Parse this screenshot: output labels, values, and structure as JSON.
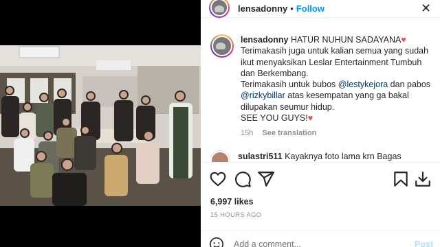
{
  "header": {
    "username": "lensadonny",
    "separator": "•",
    "follow_label": "Follow",
    "close_glyph": "✕"
  },
  "caption": {
    "username": "lensadonny",
    "line1": "HATUR NUHUN SADAYANA",
    "heart": "♥",
    "body1": "Terimakasih juga untuk kalian semua yang sudah ikut menyaksikan Leslar Entertainment Tumbuh dan Berkembang.",
    "body2_a": "Terimakasih untuk bubos ",
    "mention1": "@lestykejora",
    "body2_b": " dan pabos ",
    "mention2": "@rizkybillar",
    "body2_c": " atas kesempatan yang ga bakal dilupakan seumur hidup.",
    "body3": "SEE YOU GUYS!",
    "time": "15h",
    "see_translation": "See translation"
  },
  "comment": {
    "username": "sulastri511",
    "text": "Kayaknya foto lama krn Bagas",
    "heart_icon": "heart-outline-icon"
  },
  "actions": {
    "icons": [
      "heart-icon",
      "comment-icon",
      "share-icon",
      "bookmark-icon",
      "download-icon"
    ]
  },
  "likes": "6,997 likes",
  "timestamp": "15 HOURS AGO",
  "add_comment": {
    "placeholder": "Add a comment...",
    "post_label": "Post"
  },
  "colors": {
    "accent": "#0095f6",
    "mention": "#00376b",
    "heart": "#ed4956",
    "muted": "#8e8e8e",
    "post_disabled": "#b2dffc"
  }
}
